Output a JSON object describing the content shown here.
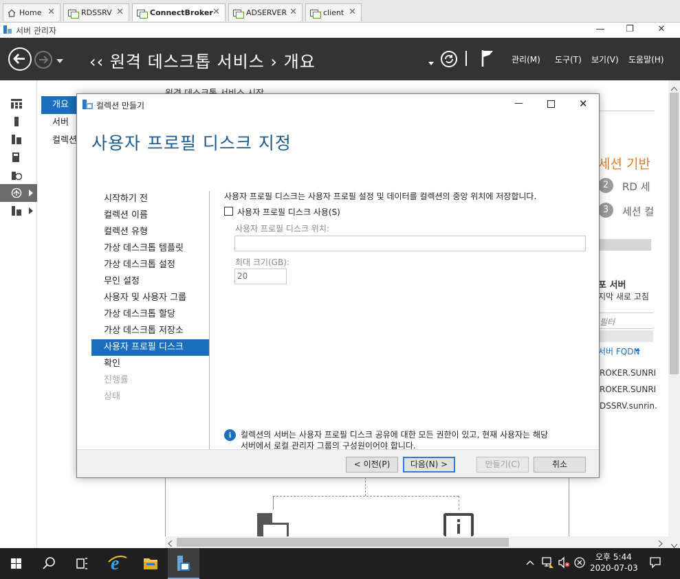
{
  "vm_tabs": [
    {
      "label": "Home"
    },
    {
      "label": "RDSSRV"
    },
    {
      "label": "ConnectBroker"
    },
    {
      "label": "ADSERVER"
    },
    {
      "label": "client"
    }
  ],
  "window": {
    "title": "서버 관리자"
  },
  "header": {
    "breadcrumb": "‹‹ 원격 데스크톱 서비스 › 개요",
    "menus": [
      "관리(M)",
      "도구(T)",
      "보기(V)",
      "도움말(H)"
    ]
  },
  "secondary_nav": [
    "개요",
    "서버",
    "컬렉션"
  ],
  "background": {
    "top_text": "원격 데스크톱 서비스 시작",
    "session_heading": "세션 기반",
    "step2": {
      "num": "2",
      "text": "RD 세"
    },
    "step3": {
      "num": "3",
      "text": "세션 컬"
    },
    "servers_heading": "포 서버",
    "servers_sub": "지막 새로 고침",
    "filter_placeholder": "필터",
    "col_header": "서버 FQDN",
    "rows": [
      "ROKER.SUNRI",
      "ROKER.SUNRI",
      "DSSRV.sunrin."
    ]
  },
  "dialog": {
    "title": "컬렉션 만들기",
    "heading": "사용자 프로필 디스크 지정",
    "steps": [
      {
        "label": "시작하기 전",
        "state": "normal"
      },
      {
        "label": "컬렉션 이름",
        "state": "normal"
      },
      {
        "label": "컬렉션 유형",
        "state": "normal"
      },
      {
        "label": "가상 데스크톱 템플릿",
        "state": "normal"
      },
      {
        "label": "가상 데스크톱 설정",
        "state": "normal"
      },
      {
        "label": "무인 설정",
        "state": "normal"
      },
      {
        "label": "사용자 및 사용자 그룹",
        "state": "normal"
      },
      {
        "label": "가상 데스크톱 할당",
        "state": "normal"
      },
      {
        "label": "가상 데스크톱 저장소",
        "state": "normal"
      },
      {
        "label": "사용자 프로필 디스크",
        "state": "selected"
      },
      {
        "label": "확인",
        "state": "normal"
      },
      {
        "label": "진행률",
        "state": "disabled"
      },
      {
        "label": "상태",
        "state": "disabled"
      }
    ],
    "description": "사용자 프로필 디스크는 사용자 프로필 설정 및 데이터를 컬렉션의 중앙 위치에 저장합니다.",
    "enable_checkbox_label": "사용자 프로필 디스크 사용(S)",
    "location_label": "사용자 프로필 디스크 위치:",
    "location_value": "",
    "max_size_label": "최대 크기(GB):",
    "max_size_value": "20",
    "info_line1": "컬렉션의 서버는 사용자 프로필 디스크 공유에 대한 모든 권한이 있고, 현재 사용자는 해당",
    "info_line2": "서버에서 로컬 관리자 그룹의 구성원이어야 합니다.",
    "buttons": {
      "prev": "< 이전(P)",
      "next": "다음(N) >",
      "create": "만들기(C)",
      "cancel": "취소"
    }
  },
  "taskbar": {
    "time": "오후 5:44",
    "date": "2020-07-03"
  }
}
